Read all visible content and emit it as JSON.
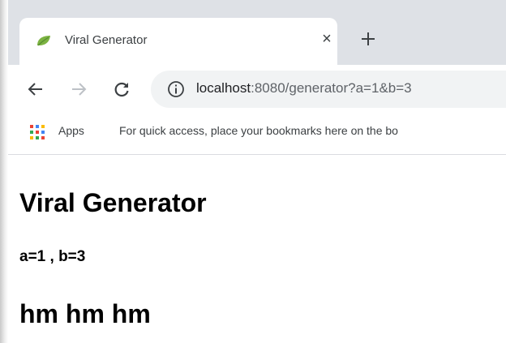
{
  "browser": {
    "tab": {
      "title": "Viral Generator",
      "close_glyph": "×",
      "favicon": "leaf-icon"
    },
    "new_tab_icon": "plus-icon",
    "toolbar": {
      "back_icon": "arrow-left-icon",
      "forward_icon": "arrow-right-icon",
      "reload_icon": "reload-icon",
      "info_icon": "info-icon",
      "url_host": "localhost",
      "url_rest": ":8080/generator?a=1&b=3"
    },
    "bookmarks": {
      "apps_label": "Apps",
      "hint": "For quick access, place your bookmarks here on the bo"
    }
  },
  "page": {
    "title": "Viral Generator",
    "params": "a=1 , b=3",
    "message": "hm hm hm"
  },
  "colors": {
    "tabstrip": "#dee1e6",
    "omnibox": "#f1f3f4",
    "favicon_green": "#7cb342"
  }
}
